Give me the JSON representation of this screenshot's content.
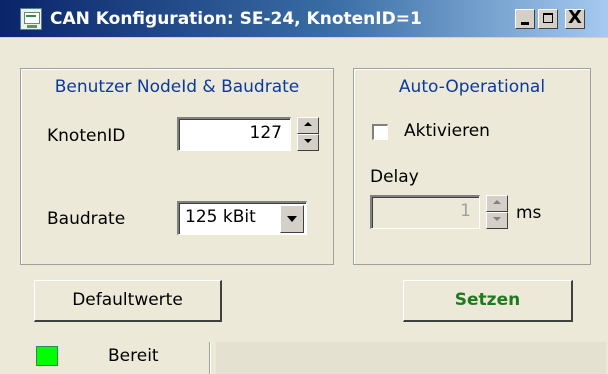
{
  "window": {
    "title": "CAN Konfiguration: SE-24, KnotenID=1",
    "icon": "can-app-icon",
    "controls": {
      "minimize": "_",
      "maximize": "□",
      "close": "X"
    }
  },
  "left_group": {
    "title": "Benutzer NodeId & Baudrate",
    "knoten_label": "KnotenID",
    "knoten_value": "127",
    "baud_label": "Baudrate",
    "baud_value": "125 kBit"
  },
  "right_group": {
    "title": "Auto-Operational",
    "checkbox_label": "Aktivieren",
    "checkbox_checked": false,
    "delay_label": "Delay",
    "delay_value": "1",
    "delay_unit": "ms"
  },
  "buttons": {
    "defaults": "Defaultwerte",
    "apply": "Setzen"
  },
  "status": {
    "text": "Bereit",
    "led_color": "#00ff00"
  },
  "colors": {
    "group_title": "#0a3a9a",
    "apply_text": "#1f7a1f",
    "titlebar_start": "#0a246a"
  }
}
